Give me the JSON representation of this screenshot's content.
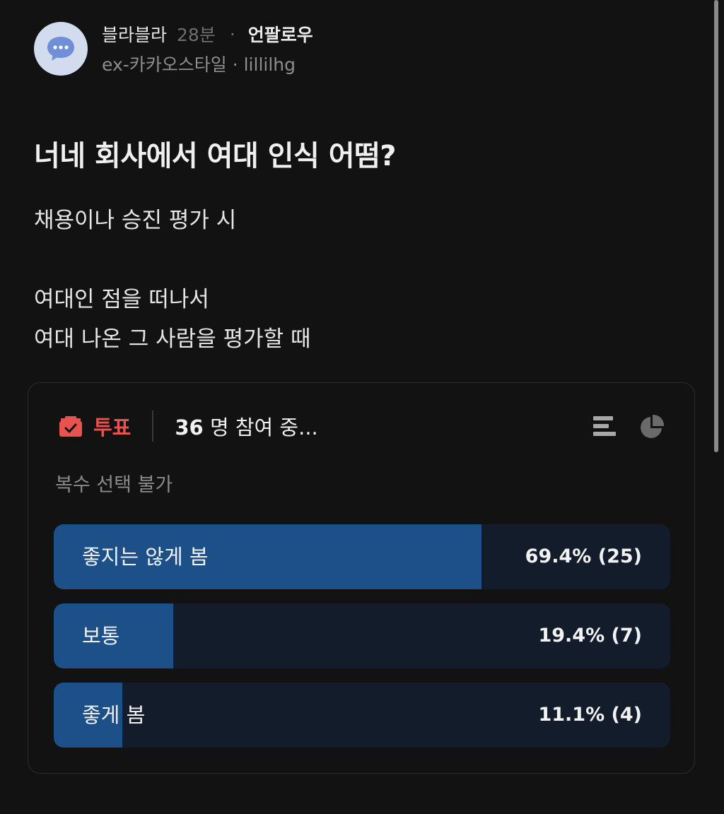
{
  "post": {
    "author": "블라블라",
    "time_ago": "28분",
    "separator": "·",
    "follow_label": "언팔로우",
    "company": "ex-카카오스타일",
    "company_separator": " · ",
    "handle": "lillilhg",
    "title": "너네 회사에서 여대 인식 어떰?",
    "body": [
      "채용이나 승진 평가 시",
      "",
      "여대인 점을 떠나서",
      "여대 나온 그 사람을 평가할 때"
    ]
  },
  "poll": {
    "label": "투표",
    "participant_count": "36",
    "participant_suffix": " 명 참여 중...",
    "subtitle": "복수 선택 불가",
    "accent_color": "#e8524f",
    "bar_color": "#1d4f88",
    "options": [
      {
        "label": "좋지는 않게 봄",
        "result": "69.4% (25)",
        "percent": 69.4
      },
      {
        "label": "보통",
        "result": "19.4% (7)",
        "percent": 19.4
      },
      {
        "label": "좋게 봄",
        "result": "11.1% (4)",
        "percent": 11.1
      }
    ],
    "icons": [
      "ballot-box-icon",
      "bar-list-view-icon",
      "pie-chart-view-icon"
    ]
  }
}
